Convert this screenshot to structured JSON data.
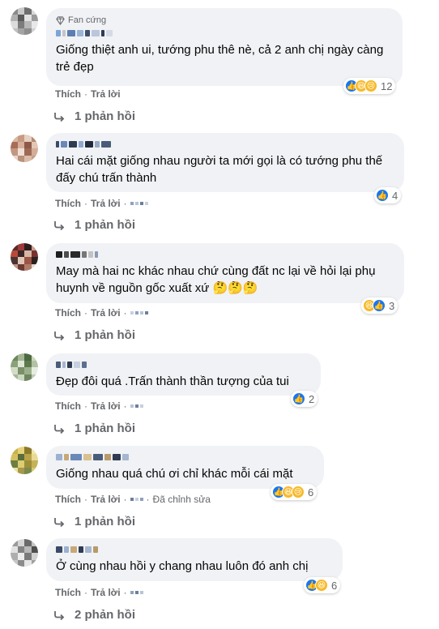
{
  "comments": [
    {
      "fan_label": "Fan cứng",
      "text": "Giống thiệt anh ui, tướng phu thê nè, cả 2 anh chị ngày càng trẻ đẹp",
      "reaction_count": "12",
      "reactions": [
        "like-icon",
        "haha-icon",
        "sad-icon"
      ],
      "like_label": "Thích",
      "reply_label": "Trả lời",
      "replies_label": "1 phản hồi"
    },
    {
      "text": "Hai cái mặt giống nhau người ta mới gọi là có tướng phu thế đấy chú trấn thành",
      "reaction_count": "4",
      "reactions": [
        "like-icon"
      ],
      "like_label": "Thích",
      "reply_label": "Trả lời",
      "replies_label": "1 phản hồi"
    },
    {
      "text": "May mà hai nc khác nhau chứ cùng đất nc lại về hỏi lại phụ huynh về nguồn gốc xuất xứ 🤔🤔🤔",
      "reaction_count": "3",
      "reactions": [
        "haha-icon",
        "like-icon"
      ],
      "like_label": "Thích",
      "reply_label": "Trả lời",
      "replies_label": "1 phản hồi"
    },
    {
      "text": "Đẹp đôi quá .Trấn thành thần tượng của tui",
      "reaction_count": "2",
      "reactions": [
        "like-icon"
      ],
      "like_label": "Thích",
      "reply_label": "Trả lời",
      "replies_label": "1 phản hồi"
    },
    {
      "text": "Giống nhau quá chú ơi chỉ khác mỗi cái mặt",
      "reaction_count": "6",
      "reactions": [
        "like-icon",
        "haha-icon",
        "sad-icon"
      ],
      "like_label": "Thích",
      "reply_label": "Trả lời",
      "edited_label": "Đã chỉnh sửa",
      "replies_label": "1 phản hồi"
    },
    {
      "text": "Ở cùng nhau hồi y chang nhau luôn đó anh chị",
      "reaction_count": "6",
      "reactions": [
        "like-icon",
        "haha-icon"
      ],
      "like_label": "Thích",
      "reply_label": "Trả lời",
      "replies_label": "2 phản hồi"
    }
  ]
}
